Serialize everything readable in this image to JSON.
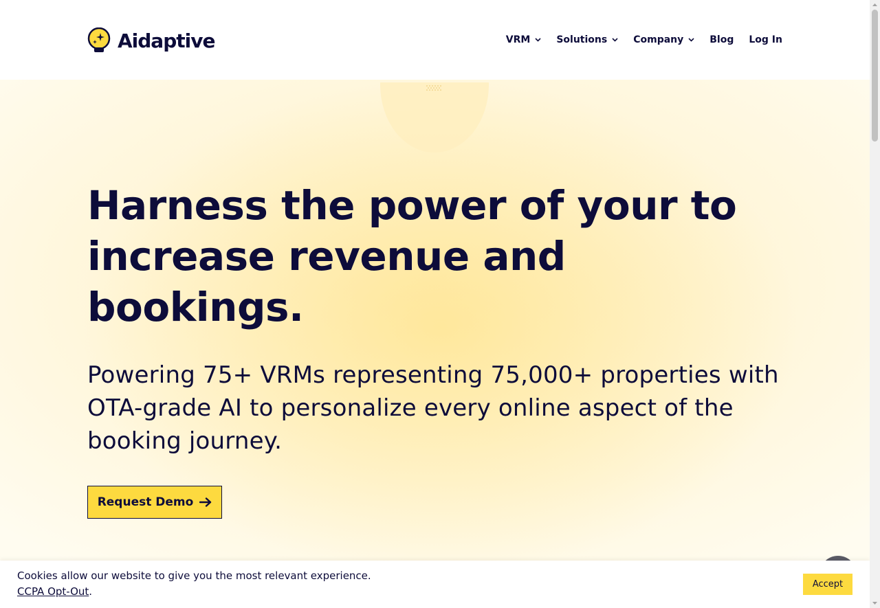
{
  "header": {
    "brand": "Aidaptive",
    "nav": [
      {
        "label": "VRM",
        "dropdown": true
      },
      {
        "label": "Solutions",
        "dropdown": true
      },
      {
        "label": "Company",
        "dropdown": true
      },
      {
        "label": "Blog",
        "dropdown": false
      },
      {
        "label": "Log In",
        "dropdown": false
      }
    ]
  },
  "hero": {
    "headline": "Harness the power of your  to increase revenue and bookings.",
    "subhead": "Powering 75+ VRMs representing 75,000+ properties with OTA-grade AI to personalize every online aspect of the booking journey.",
    "cta_label": "Request Demo",
    "cta_icon": "arrow-right-icon"
  },
  "cookie_banner": {
    "message": "Cookies allow our website to give you the most relevant experience.",
    "link_label": "CCPA Opt-Out",
    "link_suffix": ".",
    "accept_label": "Accept"
  },
  "colors": {
    "brand_navy": "#0d0c3a",
    "accent_yellow": "#fdda3f",
    "hero_background": "#fff3cf"
  },
  "icons": {
    "logo": "lightbulb-sparkle-icon",
    "dropdown": "chevron-down-icon",
    "chat": "chat-bubble-icon"
  }
}
